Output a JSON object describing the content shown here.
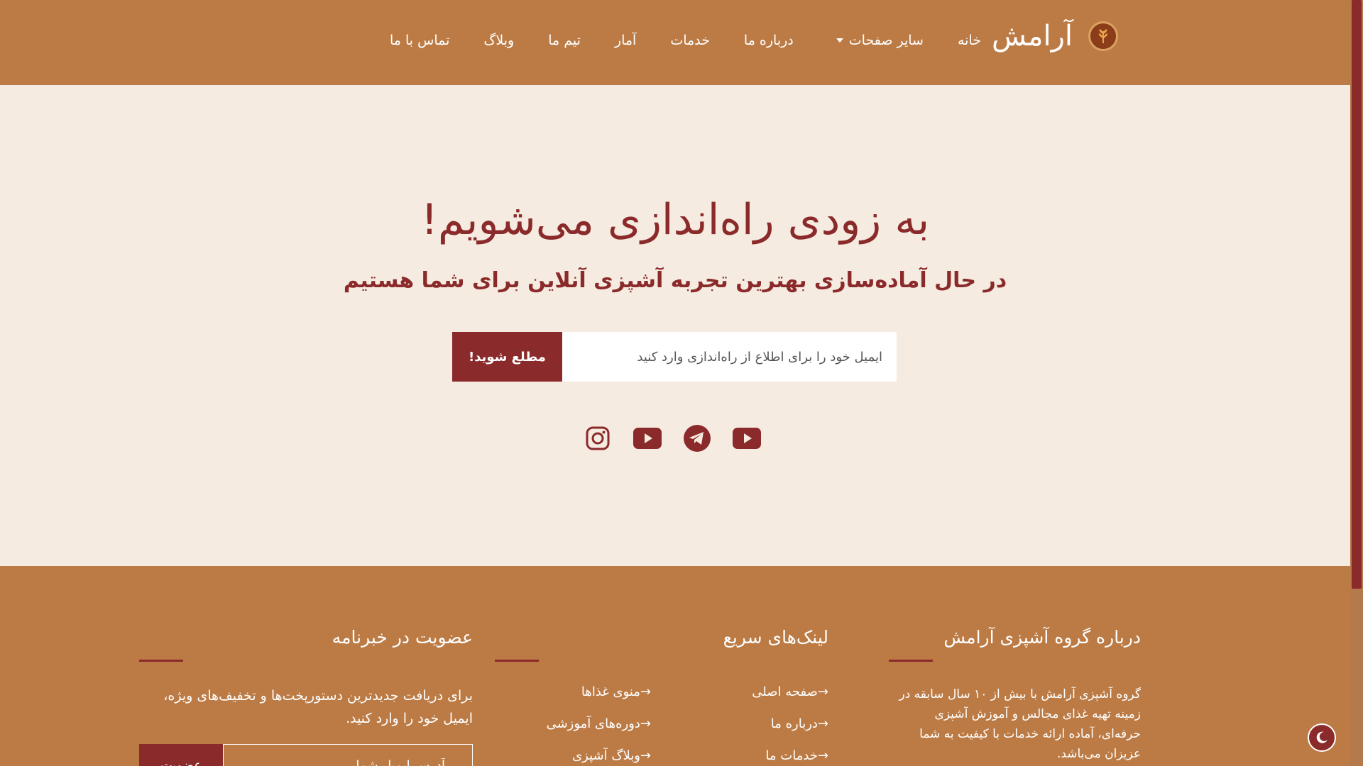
{
  "header": {
    "brand_name": "آرامش",
    "logo_icon": "wheat-logo-icon",
    "nav": [
      {
        "label": "خانه"
      },
      {
        "label": "سایر صفحات",
        "has_dropdown": true
      },
      {
        "label": "درباره ما"
      },
      {
        "label": "خدمات"
      },
      {
        "label": "آمار"
      },
      {
        "label": "تیم ما"
      },
      {
        "label": "وبلاگ"
      },
      {
        "label": "تماس با ما"
      }
    ]
  },
  "hero": {
    "title": "به زودی راه‌اندازی می‌شویم!",
    "subtitle": "در حال آماده‌سازی بهترین تجربه آشپزی آنلاین برای شما هستیم",
    "email_placeholder": "ایمیل خود را برای اطلاع از راه‌اندازی وارد کنید",
    "notify_button": "مطلع شوید!",
    "socials": [
      "instagram-icon",
      "youtube-icon",
      "telegram-icon",
      "youtube-icon"
    ]
  },
  "footer": {
    "about": {
      "title": "درباره گروه آشپزی آرامش",
      "text": "گروه آشپزی آرامش با بیش از ۱۰ سال سابقه در زمینه تهیه غذای مجالس و آموزش آشپزی حرفه‌ای، آماده ارائه خدمات با کیفیت به شما عزیزان می‌باشد."
    },
    "links": {
      "title": "لینک‌های سریع",
      "col1": [
        "→صفحه اصلی",
        "→درباره ما",
        "→خدمات ما"
      ],
      "col2": [
        "→منوی غذاها",
        "→دوره‌های آموزشی",
        "→وبلاگ آشپزی"
      ]
    },
    "newsletter": {
      "title": "عضویت در خبرنامه",
      "text": "برای دریافت جدیدترین دستورپخت‌ها و تخفیف‌های ویژه، ایمیل خود را وارد کنید.",
      "placeholder": "آدرس ایمیل شما",
      "button": "عضویت"
    }
  },
  "colors": {
    "header_bg": "#bc7b45",
    "accent": "#8b2a2a",
    "hero_bg": "#f5ebe0"
  },
  "theme_toggle_icon": "moon-icon"
}
